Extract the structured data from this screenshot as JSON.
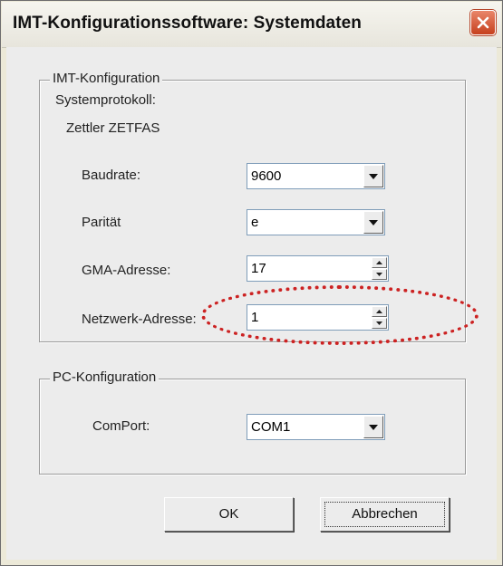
{
  "window": {
    "title": "IMT-Konfigurationssoftware: Systemdaten",
    "close_icon": "close-icon"
  },
  "imt_group": {
    "legend": "IMT-Konfiguration",
    "systemprotokoll_label": "Systemprotokoll:",
    "systemprotokoll_value": "Zettler ZETFAS",
    "baudrate": {
      "label": "Baudrate:",
      "value": "9600"
    },
    "paritaet": {
      "label": "Parität",
      "value": "e"
    },
    "gma_adresse": {
      "label": "GMA-Adresse:",
      "value": "17"
    },
    "netzwerk_adresse": {
      "label": "Netzwerk-Adresse:",
      "value": "1"
    }
  },
  "pc_group": {
    "legend": "PC-Konfiguration",
    "comport": {
      "label": "ComPort:",
      "value": "COM1"
    }
  },
  "buttons": {
    "ok": "OK",
    "cancel": "Abbrechen"
  },
  "colors": {
    "annotation": "#cc2222",
    "close_button": "#d65a36"
  }
}
